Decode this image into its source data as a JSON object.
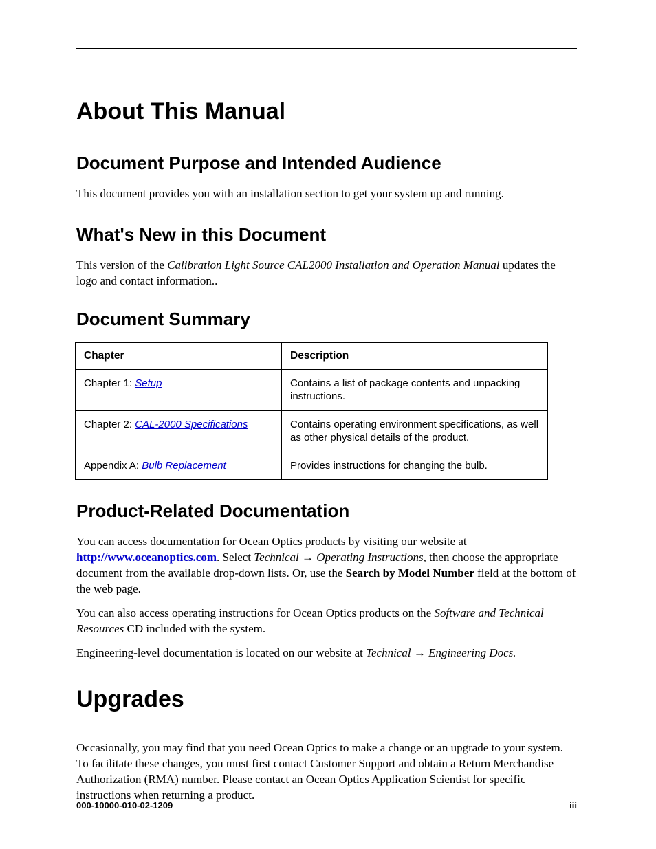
{
  "main_title": "About This Manual",
  "sections": {
    "purpose": {
      "heading": "Document Purpose and Intended Audience",
      "body": "This document provides you with an installation section to get your system up and running."
    },
    "whatsnew": {
      "heading": "What's New in this Document",
      "prefix": "This version of the ",
      "doc_title": "Calibration Light Source CAL2000 Installation and Operation Manual",
      "suffix": " updates the logo and contact information.."
    },
    "summary": {
      "heading": "Document Summary",
      "columns": {
        "chapter": "Chapter",
        "description": "Description"
      },
      "rows": [
        {
          "prefix": "Chapter 1: ",
          "link": "Setup",
          "desc": "Contains a list of package contents and unpacking instructions."
        },
        {
          "prefix": "Chapter 2: ",
          "link": "CAL-2000 Specifications",
          "desc": "Contains operating environment specifications, as well as other physical details of the product."
        },
        {
          "prefix": "Appendix A: ",
          "link": "Bulb Replacement",
          "desc": "Provides instructions for changing the bulb."
        }
      ]
    },
    "related": {
      "heading": "Product-Related Documentation",
      "p1_a": "You can access documentation for Ocean Optics products by visiting our website at ",
      "url": "http://www.oceanoptics.com",
      "p1_b": ". Select ",
      "p1_nav1": "Technical → Operating Instructions",
      "p1_c": ", then choose the appropriate document from the available drop-down lists. Or, use the ",
      "p1_bold": "Search by Model Number",
      "p1_d": " field at the bottom of the web page.",
      "p2_a": "You can also access operating instructions for Ocean Optics products on the ",
      "p2_italic": "Software and Technical Resources",
      "p2_b": " CD included with the system.",
      "p3_a": "Engineering-level documentation is located on our website at ",
      "p3_italic": "Technical → Engineering Docs."
    }
  },
  "upgrades": {
    "heading": "Upgrades",
    "body": "Occasionally, you may find that you need Ocean Optics to make a change or an upgrade to your system. To facilitate these changes, you must first contact Customer Support and obtain a Return Merchandise Authorization (RMA) number. Please contact an Ocean Optics Application Scientist for specific instructions when returning a product."
  },
  "footer": {
    "docnum": "000-10000-010-02-1209",
    "pagenum": "iii"
  }
}
